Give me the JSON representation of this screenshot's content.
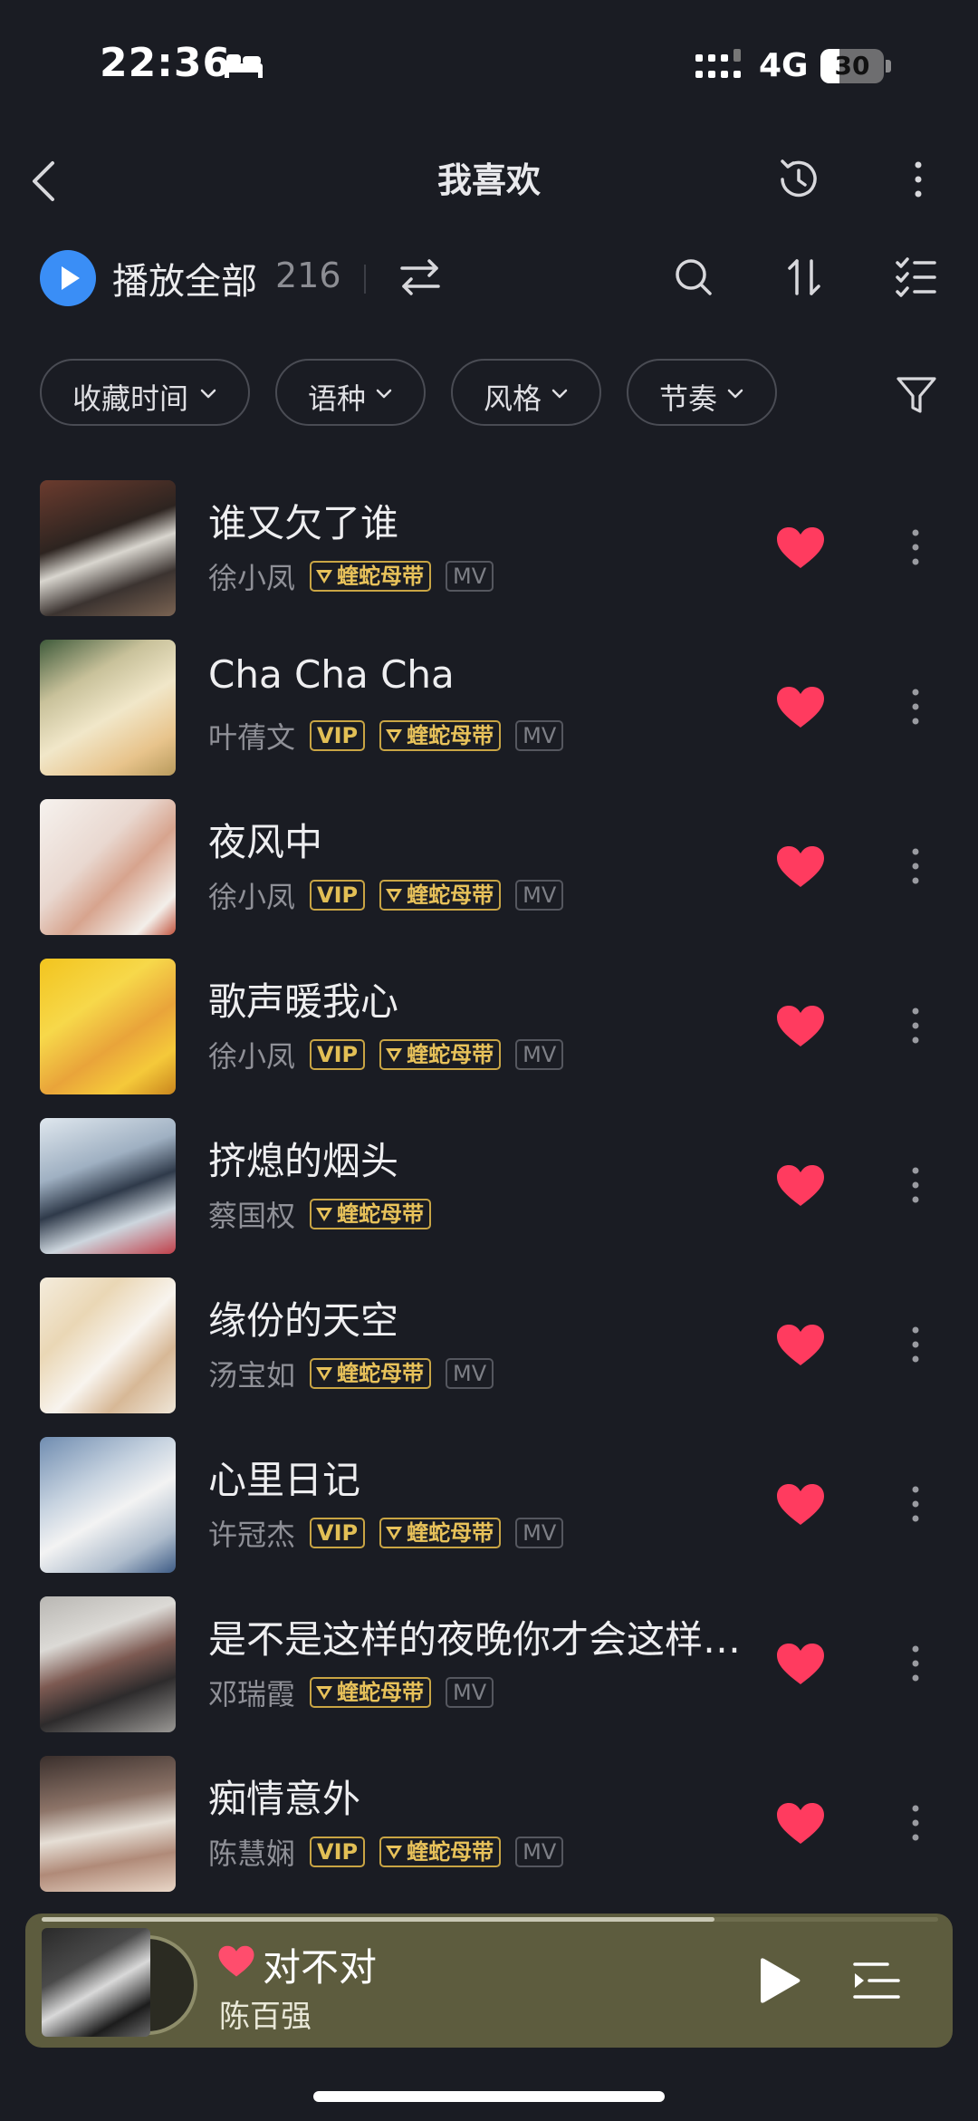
{
  "status_bar": {
    "time": "22:36",
    "network": "4G",
    "battery": "30",
    "battery_level": 0.3
  },
  "nav": {
    "title": "我喜欢"
  },
  "toolbar": {
    "play_all_label": "播放全部",
    "count": "216"
  },
  "filters": [
    {
      "label": "收藏时间"
    },
    {
      "label": "语种"
    },
    {
      "label": "风格"
    },
    {
      "label": "节奏"
    }
  ],
  "badge_labels": {
    "vip": "VIP",
    "master": "蝰蛇母带",
    "mv": "MV"
  },
  "songs": [
    {
      "title": "谁又欠了谁",
      "artist": "徐小凤",
      "vip": false,
      "master": true,
      "mv": true
    },
    {
      "title": "Cha Cha Cha",
      "artist": "叶蒨文",
      "vip": true,
      "master": true,
      "mv": true
    },
    {
      "title": "夜风中",
      "artist": "徐小凤",
      "vip": true,
      "master": true,
      "mv": true
    },
    {
      "title": "歌声暖我心",
      "artist": "徐小凤",
      "vip": true,
      "master": true,
      "mv": true
    },
    {
      "title": "挤熄的烟头",
      "artist": "蔡国权",
      "vip": false,
      "master": true,
      "mv": false
    },
    {
      "title": "缘份的天空",
      "artist": "汤宝如",
      "vip": false,
      "master": true,
      "mv": true
    },
    {
      "title": "心里日记",
      "artist": "许冠杰",
      "vip": true,
      "master": true,
      "mv": true
    },
    {
      "title": "是不是这样的夜晚你才会这样…",
      "artist": "邓瑞霞",
      "vip": false,
      "master": true,
      "mv": true
    },
    {
      "title": "痴情意外",
      "artist": "陈慧娴",
      "vip": true,
      "master": true,
      "mv": true
    }
  ],
  "mini_player": {
    "title": "对不对",
    "artist": "陈百强",
    "progress": 0.75
  },
  "colors": {
    "background": "#1a1c23",
    "accent_blue": "#3a8ef6",
    "heart": "#ff3b5f",
    "gold": "#e2bf55",
    "player_bg": "#5d5c3e"
  }
}
